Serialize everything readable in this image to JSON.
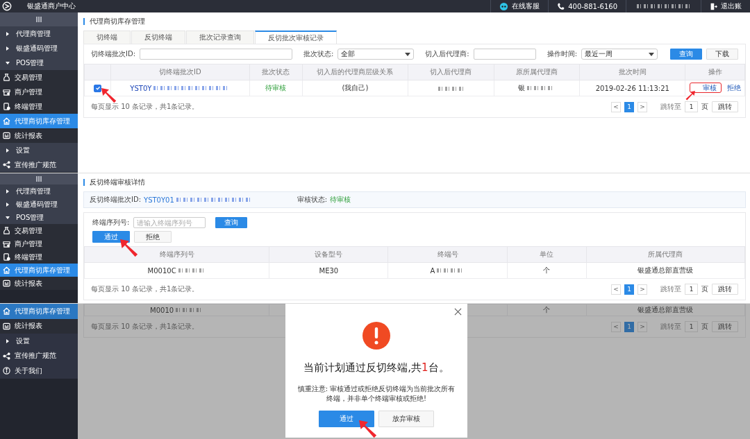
{
  "top_bar": {
    "brand": "银盛通商户中心",
    "service": "在线客服",
    "phone": "400-881-6160",
    "user_redacted": true,
    "logout": "退出账"
  },
  "screen_1": {
    "sidebar": {
      "collapse_button": true,
      "items": [
        {
          "label": "代理商管理",
          "kind": "group",
          "expanded": false
        },
        {
          "label": "银盛通码管理",
          "kind": "group",
          "expanded": false
        },
        {
          "label": "POS管理",
          "kind": "group",
          "expanded": true
        },
        {
          "label": "交易管理",
          "kind": "sub",
          "selected": false
        },
        {
          "label": "商户管理",
          "kind": "sub",
          "selected": false
        },
        {
          "label": "终端管理",
          "kind": "sub",
          "selected": false
        },
        {
          "label": "代理商切库存管理",
          "kind": "sub",
          "selected": true
        },
        {
          "label": "统计报表",
          "kind": "sub",
          "selected": false
        },
        {
          "label": "设置",
          "kind": "group",
          "expanded": false
        },
        {
          "label": "宣传推广规范",
          "kind": "link",
          "selected": false
        }
      ]
    },
    "title": "代理商切库存管理",
    "tabs": [
      {
        "label": "切终端",
        "selected": false
      },
      {
        "label": "反切终端",
        "selected": false
      },
      {
        "label": "批次记录查询",
        "selected": false
      },
      {
        "label": "反切批次审核记录",
        "selected": true
      }
    ],
    "filters": [
      {
        "label": "切终端批次ID:",
        "kind": "input"
      },
      {
        "label": "批次状态:",
        "kind": "select",
        "value": "全部"
      },
      {
        "label": "切入后代理商:",
        "kind": "input"
      },
      {
        "label": "操作时间:",
        "kind": "select",
        "value": "最近一周"
      }
    ],
    "filter_buttons": [
      {
        "label": "查询",
        "kind": "primary"
      },
      {
        "label": "下载",
        "kind": "default"
      }
    ],
    "table": {
      "columns": [
        "切终端批次ID",
        "批次状态",
        "切入后的代理商层级关系",
        "切入后代理商",
        "原所属代理商",
        "批次时间",
        "操作"
      ],
      "rows": [
        {
          "checked": true,
          "cells": [
            {
              "kind": "id",
              "text": "YST0Y",
              "redacted": true
            },
            {
              "kind": "status",
              "text": "待审核"
            },
            {
              "kind": "text",
              "text": "(我自己)"
            },
            {
              "kind": "blank",
              "redacted": true
            },
            {
              "kind": "text",
              "text": "银",
              "redacted": true
            },
            {
              "kind": "text",
              "text": "2019-02-26 11:13:21"
            },
            {
              "kind": "actions",
              "actions": [
                {
                  "label": "审核",
                  "highlighted": true
                },
                {
                  "label": "拒绝",
                  "highlighted": false
                }
              ]
            }
          ]
        }
      ]
    },
    "footer": "每页显示 10 条记录，共1条记录。",
    "pagination": {
      "prev": "<",
      "pages": [
        {
          "label": "1",
          "selected": true
        }
      ],
      "next": ">",
      "jump_label": "跳转至",
      "jump_value": "1",
      "unit": "页",
      "go": "跳转"
    }
  },
  "screen_2": {
    "sidebar": {
      "collapse_button": true,
      "items": [
        {
          "label": "代理商管理",
          "kind": "group",
          "expanded": false
        },
        {
          "label": "银盛通码管理",
          "kind": "group",
          "expanded": false
        },
        {
          "label": "POS管理",
          "kind": "group",
          "expanded": true
        },
        {
          "label": "交易管理",
          "kind": "sub",
          "selected": false
        },
        {
          "label": "商户管理",
          "kind": "sub",
          "selected": false
        },
        {
          "label": "终端管理",
          "kind": "sub",
          "selected": false
        },
        {
          "label": "代理商切库存管理",
          "kind": "sub",
          "selected": true
        },
        {
          "label": "统计报表",
          "kind": "sub",
          "selected": false
        }
      ]
    },
    "title": "反切终端审核详情",
    "info": {
      "id_label": "反切终端批次ID:",
      "id": "YST0Y01",
      "id_redacted": true,
      "status_label": "审核状态:",
      "status": "待审核"
    },
    "search": {
      "label": "终端序列号:",
      "placeholder": "请输入终端序列号",
      "button": "查询"
    },
    "actions": [
      {
        "label": "通过",
        "kind": "primary"
      },
      {
        "label": "拒绝",
        "kind": "default"
      }
    ],
    "table": {
      "columns": [
        "终端序列号",
        "设备型号",
        "终端号",
        "单位",
        "所属代理商"
      ],
      "rows": [
        {
          "cells": [
            {
              "kind": "text",
              "text": "M0010C",
              "redacted": true
            },
            {
              "kind": "text",
              "text": "ME30"
            },
            {
              "kind": "text",
              "text": "A",
              "redacted": true
            },
            {
              "kind": "text",
              "text": "个"
            },
            {
              "kind": "text",
              "text": "银盛通总部直营级"
            }
          ]
        }
      ]
    },
    "footer": "每页显示 10 条记录，共1条记录。",
    "pagination": {
      "prev": "<",
      "pages": [
        {
          "label": "1",
          "selected": true
        }
      ],
      "next": ">",
      "jump_label": "跳转至",
      "jump_value": "1",
      "unit": "页",
      "go": "跳转"
    }
  },
  "screen_3": {
    "sidebar": {
      "items": [
        {
          "label": "代理商切库存管理",
          "kind": "sub",
          "selected": true
        },
        {
          "label": "统计报表",
          "kind": "sub",
          "selected": false
        },
        {
          "label": "设置",
          "kind": "group",
          "expanded": false
        },
        {
          "label": "宣传推广规范",
          "kind": "link",
          "selected": false
        },
        {
          "label": "关于我们",
          "kind": "link",
          "selected": false
        }
      ]
    },
    "table": {
      "rows": [
        {
          "cells": [
            {
              "kind": "text",
              "text": "M0010",
              "redacted": true
            },
            {
              "kind": "blank"
            },
            {
              "kind": "blank"
            },
            {
              "kind": "text",
              "text": "个"
            },
            {
              "kind": "text",
              "text": "银盛通总部直营级"
            }
          ]
        }
      ]
    },
    "footer": "每页显示 10 条记录，共1条记录。",
    "pagination": {
      "prev": "<",
      "pages": [
        {
          "label": "1",
          "selected": true
        }
      ],
      "next": ">",
      "jump_label": "跳转至",
      "jump_value": "1",
      "unit": "页",
      "go": "跳转"
    },
    "dialog": {
      "title_before": "当前计划通过反切终端,共",
      "count": "1",
      "title_after": "台。",
      "note": "慎重注意: 审核通过或拒绝反切终端为当前批次所有终端，并非单个终端审核或拒绝!",
      "buttons": [
        {
          "label": "通过",
          "kind": "primary"
        },
        {
          "label": "放弃审核",
          "kind": "default"
        }
      ]
    }
  }
}
